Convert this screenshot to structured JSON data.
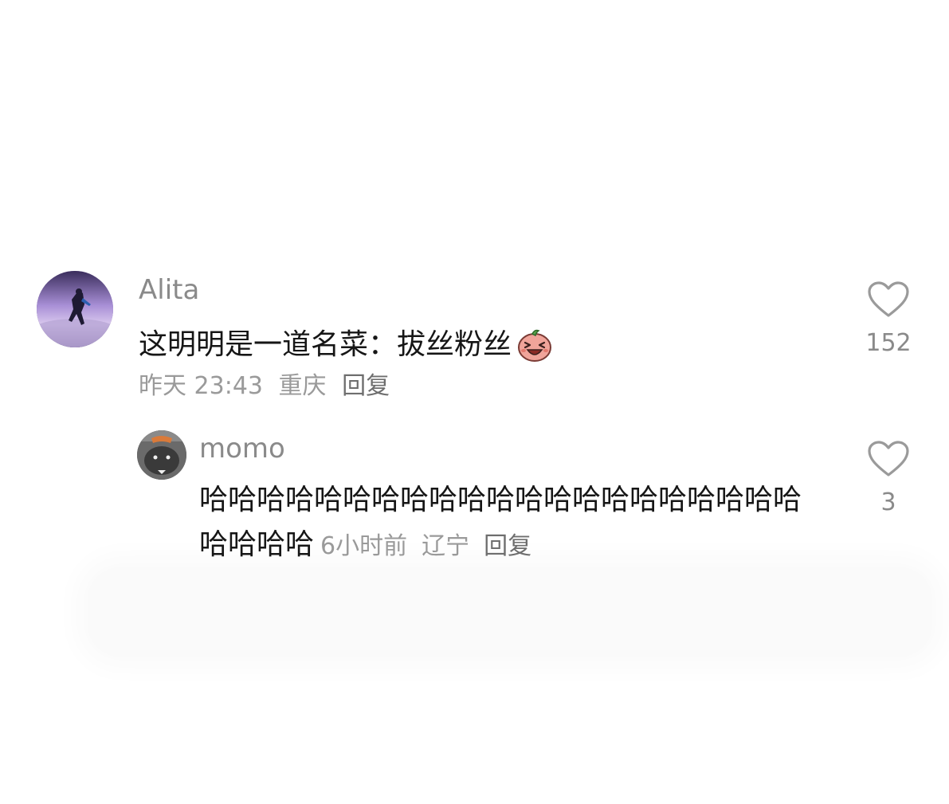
{
  "comment": {
    "username": "Alita",
    "text": "这明明是一道名菜：拔丝粉丝",
    "emoji": "laughing-emoji",
    "time": "昨天 23:43",
    "location": "重庆",
    "reply_label": "回复",
    "likes": "152"
  },
  "reply": {
    "username": "momo",
    "text": "哈哈哈哈哈哈哈哈哈哈哈哈哈哈哈哈哈哈哈哈哈哈哈哈哈",
    "time": "6小时前",
    "location": "辽宁",
    "reply_label": "回复",
    "likes": "3"
  },
  "icons": {
    "like": "heart-outline-icon"
  },
  "colors": {
    "username": "#8a8a8a",
    "text": "#161616",
    "meta": "#9a9a9a"
  }
}
